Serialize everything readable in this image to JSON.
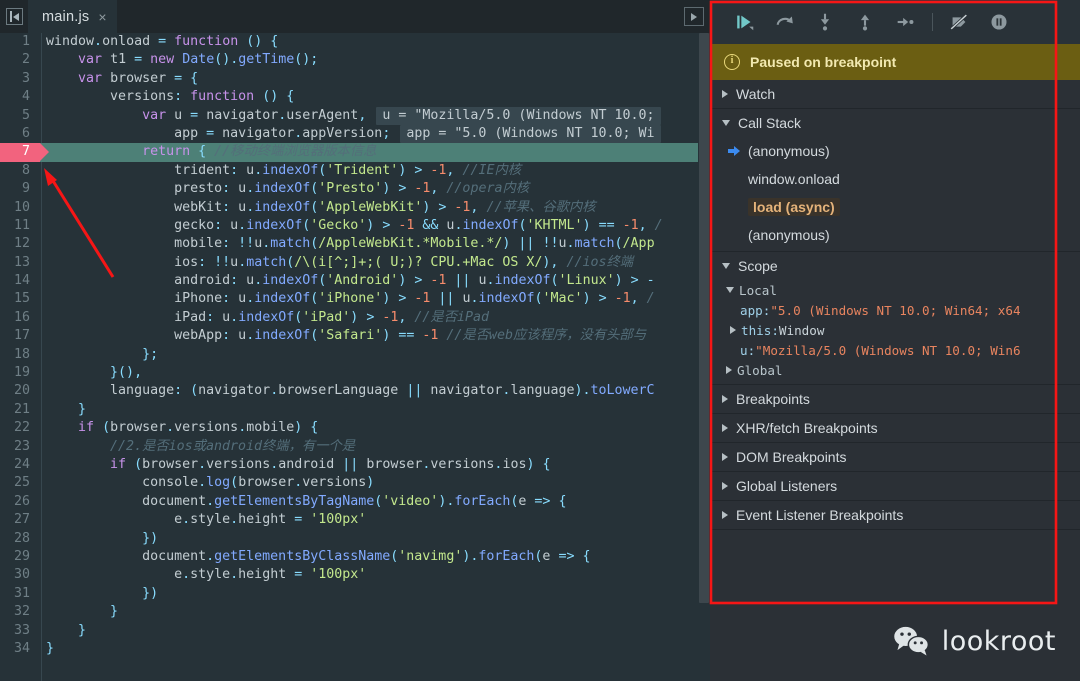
{
  "editor": {
    "panel_toggle_icon": "panel-toggle-icon",
    "tab": {
      "label": "main.js",
      "close": "×"
    },
    "more_tabs_icon": "chevron-right-icon",
    "lines": [
      {
        "n": 1,
        "html": "<span class='v'>window</span><span class='p'>.</span><span class='v'>onload</span> <span class='p'>=</span> <span class='k'>function</span> <span class='p'>()</span> <span class='p'>{</span>"
      },
      {
        "n": 2,
        "html": "    <span class='k'>var</span> <span class='v'>t1</span> <span class='p'>=</span> <span class='k'>new</span> <span class='fn'>Date</span><span class='p'>().</span><span class='fn'>getTime</span><span class='p'>();</span>"
      },
      {
        "n": 3,
        "html": "    <span class='k'>var</span> <span class='v'>browser</span> <span class='p'>=</span> <span class='p'>{</span>"
      },
      {
        "n": 4,
        "html": "        <span class='prop'>versions</span><span class='p'>:</span> <span class='k'>function</span> <span class='p'>()</span> <span class='p'>{</span>"
      },
      {
        "n": 5,
        "html": "            <span class='k'>var</span> <span class='v'>u</span> <span class='p'>=</span> <span class='v'>navigator</span><span class='p'>.</span><span class='v'>userAgent</span><span class='p'>,</span><span class='inlinehint'>u = \"Mozilla/5.0 (Windows NT 10.0;</span>"
      },
      {
        "n": 6,
        "html": "                <span class='v'>app</span> <span class='p'>=</span> <span class='v'>navigator</span><span class='p'>.</span><span class='v'>appVersion</span><span class='p'>;</span><span class='inlinehint'>app = \"5.0 (Windows NT 10.0; Wi</span>"
      },
      {
        "n": 7,
        "html": "            <span class='k'>return</span> <span class='p'>{</span> <span class='c'>//移动终端浏览器版本信息</span>",
        "breakpoint": true,
        "highlight": true
      },
      {
        "n": 8,
        "html": "                <span class='prop'>trident</span><span class='p'>:</span> <span class='v'>u</span><span class='p'>.</span><span class='fn'>indexOf</span><span class='p'>(</span><span class='s'>'Trident'</span><span class='p'>)</span> <span class='p'>&gt;</span> <span class='n'>-1</span><span class='p'>,</span> <span class='c'>//IE内核</span>"
      },
      {
        "n": 9,
        "html": "                <span class='prop'>presto</span><span class='p'>:</span> <span class='v'>u</span><span class='p'>.</span><span class='fn'>indexOf</span><span class='p'>(</span><span class='s'>'Presto'</span><span class='p'>)</span> <span class='p'>&gt;</span> <span class='n'>-1</span><span class='p'>,</span> <span class='c'>//opera内核</span>"
      },
      {
        "n": 10,
        "html": "                <span class='prop'>webKit</span><span class='p'>:</span> <span class='v'>u</span><span class='p'>.</span><span class='fn'>indexOf</span><span class='p'>(</span><span class='s'>'AppleWebKit'</span><span class='p'>)</span> <span class='p'>&gt;</span> <span class='n'>-1</span><span class='p'>,</span> <span class='c'>//苹果、谷歌内核</span>"
      },
      {
        "n": 11,
        "html": "                <span class='prop'>gecko</span><span class='p'>:</span> <span class='v'>u</span><span class='p'>.</span><span class='fn'>indexOf</span><span class='p'>(</span><span class='s'>'Gecko'</span><span class='p'>)</span> <span class='p'>&gt;</span> <span class='n'>-1</span> <span class='p'>&amp;&amp;</span> <span class='v'>u</span><span class='p'>.</span><span class='fn'>indexOf</span><span class='p'>(</span><span class='s'>'KHTML'</span><span class='p'>)</span> <span class='p'>==</span> <span class='n'>-1</span><span class='p'>,</span> <span class='c'>/</span>"
      },
      {
        "n": 12,
        "html": "                <span class='prop'>mobile</span><span class='p'>:</span> <span class='p'>!!</span><span class='v'>u</span><span class='p'>.</span><span class='fn'>match</span><span class='p'>(</span><span class='s'>/AppleWebKit.*Mobile.*/</span><span class='p'>)</span> <span class='p'>||</span> <span class='p'>!!</span><span class='v'>u</span><span class='p'>.</span><span class='fn'>match</span><span class='p'>(</span><span class='s'>/App</span>"
      },
      {
        "n": 13,
        "html": "                <span class='prop'>ios</span><span class='p'>:</span> <span class='p'>!!</span><span class='v'>u</span><span class='p'>.</span><span class='fn'>match</span><span class='p'>(</span><span class='s'>/\\(i[^;]+;( U;)? CPU.+Mac OS X/</span><span class='p'>),</span> <span class='c'>//ios终端</span>"
      },
      {
        "n": 14,
        "html": "                <span class='prop'>android</span><span class='p'>:</span> <span class='v'>u</span><span class='p'>.</span><span class='fn'>indexOf</span><span class='p'>(</span><span class='s'>'Android'</span><span class='p'>)</span> <span class='p'>&gt;</span> <span class='n'>-1</span> <span class='p'>||</span> <span class='v'>u</span><span class='p'>.</span><span class='fn'>indexOf</span><span class='p'>(</span><span class='s'>'Linux'</span><span class='p'>)</span> <span class='p'>&gt;</span> <span class='p'>-</span>"
      },
      {
        "n": 15,
        "html": "                <span class='prop'>iPhone</span><span class='p'>:</span> <span class='v'>u</span><span class='p'>.</span><span class='fn'>indexOf</span><span class='p'>(</span><span class='s'>'iPhone'</span><span class='p'>)</span> <span class='p'>&gt;</span> <span class='n'>-1</span> <span class='p'>||</span> <span class='v'>u</span><span class='p'>.</span><span class='fn'>indexOf</span><span class='p'>(</span><span class='s'>'Mac'</span><span class='p'>)</span> <span class='p'>&gt;</span> <span class='n'>-1</span><span class='p'>,</span> <span class='c'>/</span>"
      },
      {
        "n": 16,
        "html": "                <span class='prop'>iPad</span><span class='p'>:</span> <span class='v'>u</span><span class='p'>.</span><span class='fn'>indexOf</span><span class='p'>(</span><span class='s'>'iPad'</span><span class='p'>)</span> <span class='p'>&gt;</span> <span class='n'>-1</span><span class='p'>,</span> <span class='c'>//是否iPad</span>"
      },
      {
        "n": 17,
        "html": "                <span class='prop'>webApp</span><span class='p'>:</span> <span class='v'>u</span><span class='p'>.</span><span class='fn'>indexOf</span><span class='p'>(</span><span class='s'>'Safari'</span><span class='p'>)</span> <span class='p'>==</span> <span class='n'>-1</span> <span class='c'>//是否web应该程序，没有头部与</span>"
      },
      {
        "n": 18,
        "html": "            <span class='p'>};</span>"
      },
      {
        "n": 19,
        "html": "        <span class='p'>}(),</span>"
      },
      {
        "n": 20,
        "html": "        <span class='prop'>language</span><span class='p'>:</span> <span class='p'>(</span><span class='v'>navigator</span><span class='p'>.</span><span class='v'>browserLanguage</span> <span class='p'>||</span> <span class='v'>navigator</span><span class='p'>.</span><span class='v'>language</span><span class='p'>).</span><span class='fn'>toLowerC</span>"
      },
      {
        "n": 21,
        "html": "    <span class='p'>}</span>"
      },
      {
        "n": 22,
        "html": "    <span class='k'>if</span> <span class='p'>(</span><span class='v'>browser</span><span class='p'>.</span><span class='v'>versions</span><span class='p'>.</span><span class='v'>mobile</span><span class='p'>)</span> <span class='p'>{</span>"
      },
      {
        "n": 23,
        "html": "        <span class='c'>//2.是否ios或android终端，有一个是</span>"
      },
      {
        "n": 24,
        "html": "        <span class='k'>if</span> <span class='p'>(</span><span class='v'>browser</span><span class='p'>.</span><span class='v'>versions</span><span class='p'>.</span><span class='v'>android</span> <span class='p'>||</span> <span class='v'>browser</span><span class='p'>.</span><span class='v'>versions</span><span class='p'>.</span><span class='v'>ios</span><span class='p'>)</span> <span class='p'>{</span>"
      },
      {
        "n": 25,
        "html": "            <span class='v'>console</span><span class='p'>.</span><span class='fn'>log</span><span class='p'>(</span><span class='v'>browser</span><span class='p'>.</span><span class='v'>versions</span><span class='p'>)</span>"
      },
      {
        "n": 26,
        "html": "            <span class='v'>document</span><span class='p'>.</span><span class='fn'>getElementsByTagName</span><span class='p'>(</span><span class='s'>'video'</span><span class='p'>).</span><span class='fn'>forEach</span><span class='p'>(</span><span class='v'>e</span> <span class='p'>=&gt;</span> <span class='p'>{</span>"
      },
      {
        "n": 27,
        "html": "                <span class='v'>e</span><span class='p'>.</span><span class='v'>style</span><span class='p'>.</span><span class='v'>height</span> <span class='p'>=</span> <span class='s'>'100px'</span>"
      },
      {
        "n": 28,
        "html": "            <span class='p'>})</span>"
      },
      {
        "n": 29,
        "html": "            <span class='v'>document</span><span class='p'>.</span><span class='fn'>getElementsByClassName</span><span class='p'>(</span><span class='s'>'navimg'</span><span class='p'>).</span><span class='fn'>forEach</span><span class='p'>(</span><span class='v'>e</span> <span class='p'>=&gt;</span> <span class='p'>{</span>"
      },
      {
        "n": 30,
        "html": "                <span class='v'>e</span><span class='p'>.</span><span class='v'>style</span><span class='p'>.</span><span class='v'>height</span> <span class='p'>=</span> <span class='s'>'100px'</span>"
      },
      {
        "n": 31,
        "html": "            <span class='p'>})</span>"
      },
      {
        "n": 32,
        "html": "        <span class='p'>}</span>"
      },
      {
        "n": 33,
        "html": "    <span class='p'>}</span>"
      },
      {
        "n": 34,
        "html": "<span class='p'>}</span>"
      }
    ]
  },
  "debugger": {
    "toolbar": [
      {
        "name": "resume-button",
        "icon": "resume-icon"
      },
      {
        "name": "step-over-button",
        "icon": "step-over-icon"
      },
      {
        "name": "step-into-button",
        "icon": "step-into-icon"
      },
      {
        "name": "step-out-button",
        "icon": "step-out-icon"
      },
      {
        "name": "step-button",
        "icon": "step-icon"
      },
      {
        "name": "deactivate-breakpoints-button",
        "icon": "deactivate-breakpoints-icon"
      },
      {
        "name": "pause-on-exceptions-button",
        "icon": "pause-on-exceptions-icon"
      }
    ],
    "status": {
      "icon": "info-icon",
      "text": "Paused on breakpoint"
    },
    "sections": [
      {
        "title": "Watch",
        "expanded": false
      },
      {
        "title": "Call Stack",
        "expanded": true
      },
      {
        "title": "Scope",
        "expanded": true
      },
      {
        "title": "Breakpoints",
        "expanded": false
      },
      {
        "title": "XHR/fetch Breakpoints",
        "expanded": false
      },
      {
        "title": "DOM Breakpoints",
        "expanded": false
      },
      {
        "title": "Global Listeners",
        "expanded": false
      },
      {
        "title": "Event Listener Breakpoints",
        "expanded": false
      }
    ],
    "call_stack": [
      {
        "label": "(anonymous)",
        "current": true,
        "async": false
      },
      {
        "label": "window.onload",
        "current": false,
        "async": false
      },
      {
        "label": "load (async)",
        "current": false,
        "async": true
      },
      {
        "label": "(anonymous)",
        "current": false,
        "async": false
      }
    ],
    "scope": {
      "local_label": "Local",
      "global_label": "Global",
      "entries": [
        {
          "key": "app",
          "sep": ": ",
          "value": "\"5.0 (Windows NT 10.0; Win64; x64",
          "type": "string",
          "caret": false
        },
        {
          "key": "this",
          "sep": ": ",
          "value": "Window",
          "type": "object",
          "caret": true
        },
        {
          "key": "u",
          "sep": ": ",
          "value": "\"Mozilla/5.0 (Windows NT 10.0; Win6",
          "type": "string",
          "caret": false
        }
      ]
    }
  },
  "watermark": {
    "icon": "wechat-icon",
    "text": "lookroot"
  },
  "annotation": {
    "color": "#f61616",
    "shapes": "red-box-and-arrow"
  },
  "colors": {
    "editor_bg": "#263238",
    "panel_bg": "#2b3036",
    "paused_bg": "#6b5e12",
    "highlight_line": "#4d8077",
    "breakpoint": "#f2637e",
    "accent_blue": "#3c8bf0",
    "annotation_red": "#f61616"
  }
}
